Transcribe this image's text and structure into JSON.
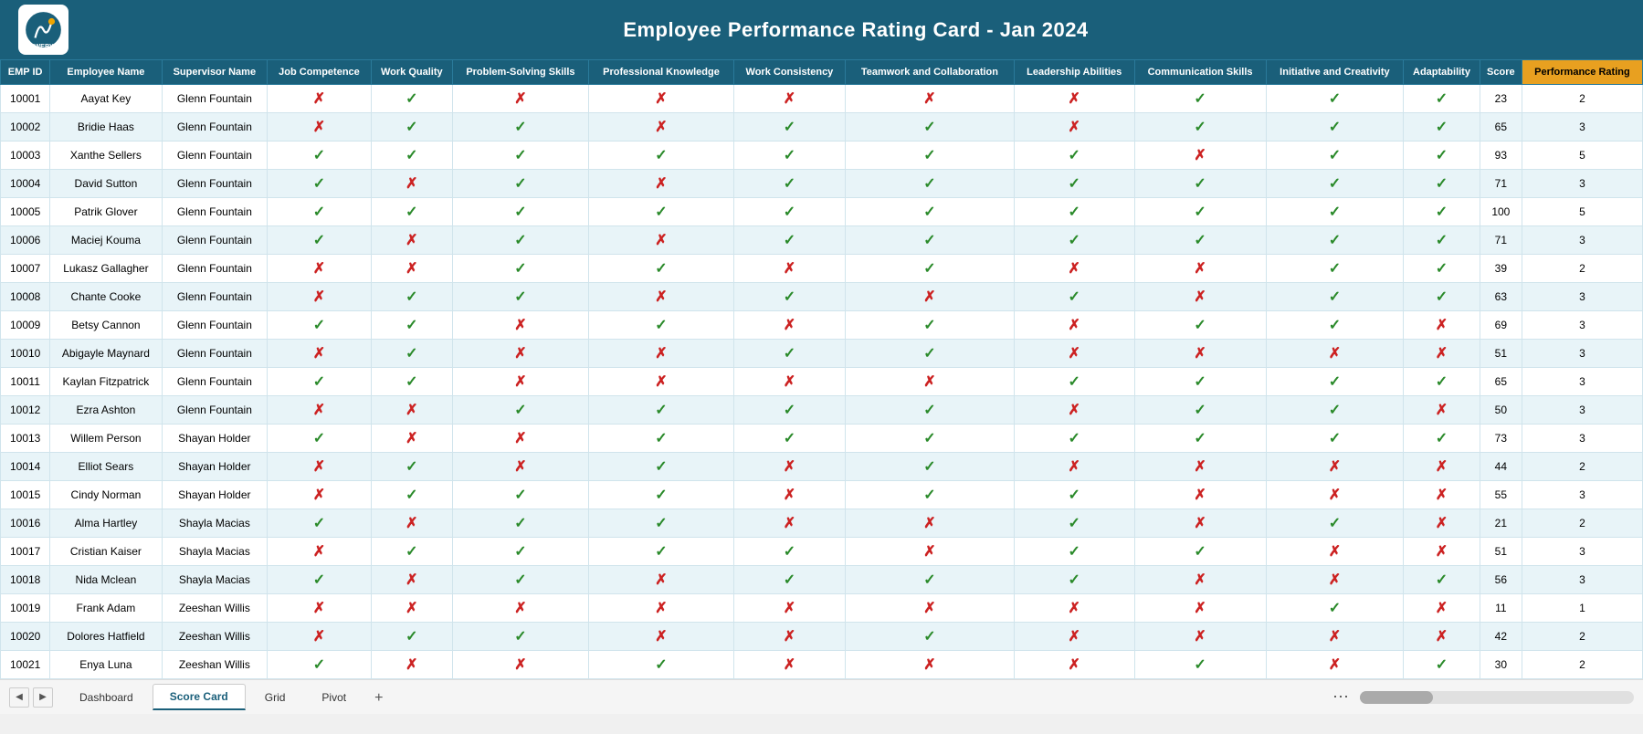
{
  "title": "Employee Performance Rating Card - Jan 2024",
  "columns": [
    "EMP ID",
    "Employee Name",
    "Supervisor Name",
    "Job Competence",
    "Work Quality",
    "Problem-Solving Skills",
    "Professional Knowledge",
    "Work Consistency",
    "Teamwork and Collaboration",
    "Leadership Abilities",
    "Communication Skills",
    "Initiative and Creativity",
    "Adaptability",
    "Score",
    "Performance Rating"
  ],
  "rows": [
    [
      "10001",
      "Aayat Key",
      "Glenn Fountain",
      "✗",
      "✓",
      "✗",
      "✗",
      "✗",
      "✗",
      "✗",
      "✓",
      "✓",
      "✓",
      "23",
      "2"
    ],
    [
      "10002",
      "Bridie Haas",
      "Glenn Fountain",
      "✗",
      "✓",
      "✓",
      "✗",
      "✓",
      "✓",
      "✗",
      "✓",
      "✓",
      "✓",
      "65",
      "3"
    ],
    [
      "10003",
      "Xanthe Sellers",
      "Glenn Fountain",
      "✓",
      "✓",
      "✓",
      "✓",
      "✓",
      "✓",
      "✓",
      "✗",
      "✓",
      "✓",
      "93",
      "5"
    ],
    [
      "10004",
      "David Sutton",
      "Glenn Fountain",
      "✓",
      "✗",
      "✓",
      "✗",
      "✓",
      "✓",
      "✓",
      "✓",
      "✓",
      "✓",
      "71",
      "3"
    ],
    [
      "10005",
      "Patrik Glover",
      "Glenn Fountain",
      "✓",
      "✓",
      "✓",
      "✓",
      "✓",
      "✓",
      "✓",
      "✓",
      "✓",
      "✓",
      "100",
      "5"
    ],
    [
      "10006",
      "Maciej Kouma",
      "Glenn Fountain",
      "✓",
      "✗",
      "✓",
      "✗",
      "✓",
      "✓",
      "✓",
      "✓",
      "✓",
      "✓",
      "71",
      "3"
    ],
    [
      "10007",
      "Lukasz Gallagher",
      "Glenn Fountain",
      "✗",
      "✗",
      "✓",
      "✓",
      "✗",
      "✓",
      "✗",
      "✗",
      "✓",
      "✓",
      "39",
      "2"
    ],
    [
      "10008",
      "Chante Cooke",
      "Glenn Fountain",
      "✗",
      "✓",
      "✓",
      "✗",
      "✓",
      "✗",
      "✓",
      "✗",
      "✓",
      "✓",
      "63",
      "3"
    ],
    [
      "10009",
      "Betsy Cannon",
      "Glenn Fountain",
      "✓",
      "✓",
      "✗",
      "✓",
      "✗",
      "✓",
      "✗",
      "✓",
      "✓",
      "✗",
      "69",
      "3"
    ],
    [
      "10010",
      "Abigayle Maynard",
      "Glenn Fountain",
      "✗",
      "✓",
      "✗",
      "✗",
      "✓",
      "✓",
      "✗",
      "✗",
      "✗",
      "✗",
      "51",
      "3"
    ],
    [
      "10011",
      "Kaylan Fitzpatrick",
      "Glenn Fountain",
      "✓",
      "✓",
      "✗",
      "✗",
      "✗",
      "✗",
      "✓",
      "✓",
      "✓",
      "✓",
      "65",
      "3"
    ],
    [
      "10012",
      "Ezra Ashton",
      "Glenn Fountain",
      "✗",
      "✗",
      "✓",
      "✓",
      "✓",
      "✓",
      "✗",
      "✓",
      "✓",
      "✗",
      "50",
      "3"
    ],
    [
      "10013",
      "Willem Person",
      "Shayan Holder",
      "✓",
      "✗",
      "✗",
      "✓",
      "✓",
      "✓",
      "✓",
      "✓",
      "✓",
      "✓",
      "73",
      "3"
    ],
    [
      "10014",
      "Elliot Sears",
      "Shayan Holder",
      "✗",
      "✓",
      "✗",
      "✓",
      "✗",
      "✓",
      "✗",
      "✗",
      "✗",
      "✗",
      "44",
      "2"
    ],
    [
      "10015",
      "Cindy Norman",
      "Shayan Holder",
      "✗",
      "✓",
      "✓",
      "✓",
      "✗",
      "✓",
      "✓",
      "✗",
      "✗",
      "✗",
      "55",
      "3"
    ],
    [
      "10016",
      "Alma Hartley",
      "Shayla Macias",
      "✓",
      "✗",
      "✓",
      "✓",
      "✗",
      "✗",
      "✓",
      "✗",
      "✓",
      "✗",
      "21",
      "2"
    ],
    [
      "10017",
      "Cristian Kaiser",
      "Shayla Macias",
      "✗",
      "✓",
      "✓",
      "✓",
      "✓",
      "✗",
      "✓",
      "✓",
      "✗",
      "✗",
      "51",
      "3"
    ],
    [
      "10018",
      "Nida Mclean",
      "Shayla Macias",
      "✓",
      "✗",
      "✓",
      "✗",
      "✓",
      "✓",
      "✓",
      "✗",
      "✗",
      "✓",
      "56",
      "3"
    ],
    [
      "10019",
      "Frank Adam",
      "Zeeshan Willis",
      "✗",
      "✗",
      "✗",
      "✗",
      "✗",
      "✗",
      "✗",
      "✗",
      "✓",
      "✗",
      "11",
      "1"
    ],
    [
      "10020",
      "Dolores Hatfield",
      "Zeeshan Willis",
      "✗",
      "✓",
      "✓",
      "✗",
      "✗",
      "✓",
      "✗",
      "✗",
      "✗",
      "✗",
      "42",
      "2"
    ],
    [
      "10021",
      "Enya Luna",
      "Zeeshan Willis",
      "✓",
      "✗",
      "✗",
      "✓",
      "✗",
      "✗",
      "✗",
      "✓",
      "✗",
      "✓",
      "30",
      "2"
    ]
  ],
  "tabs": [
    "Dashboard",
    "Score Card",
    "Grid",
    "Pivot"
  ],
  "active_tab": "Score Card",
  "tab_add_label": "+",
  "nav_prev": "◀",
  "nav_next": "▶",
  "dots_label": "⋯"
}
